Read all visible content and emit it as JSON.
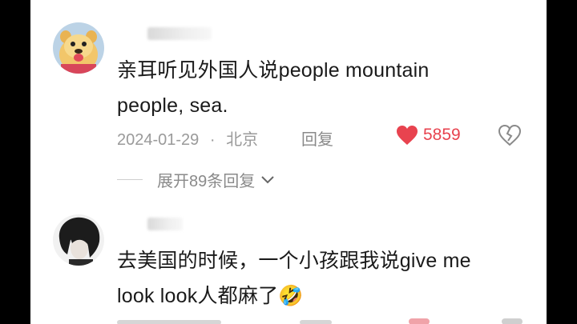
{
  "comments": [
    {
      "avatar": "cartoon-character-avatar",
      "text_line1": "亲耳听见外国人说people mountain",
      "text_line2": "people, sea.",
      "date": "2024-01-29",
      "separator": "·",
      "location": "北京",
      "reply_label": "回复",
      "likes": "5859",
      "expand_label": "展开89条回复"
    },
    {
      "avatar": "dark-hair-portrait-avatar",
      "text_line1": "去美国的时候，一个小孩跟我说give me",
      "text_line2": "look look人都麻了🤣"
    }
  ],
  "colors": {
    "like": "#e8434f",
    "meta": "#9a9a9a",
    "text": "#1a1a1a"
  }
}
